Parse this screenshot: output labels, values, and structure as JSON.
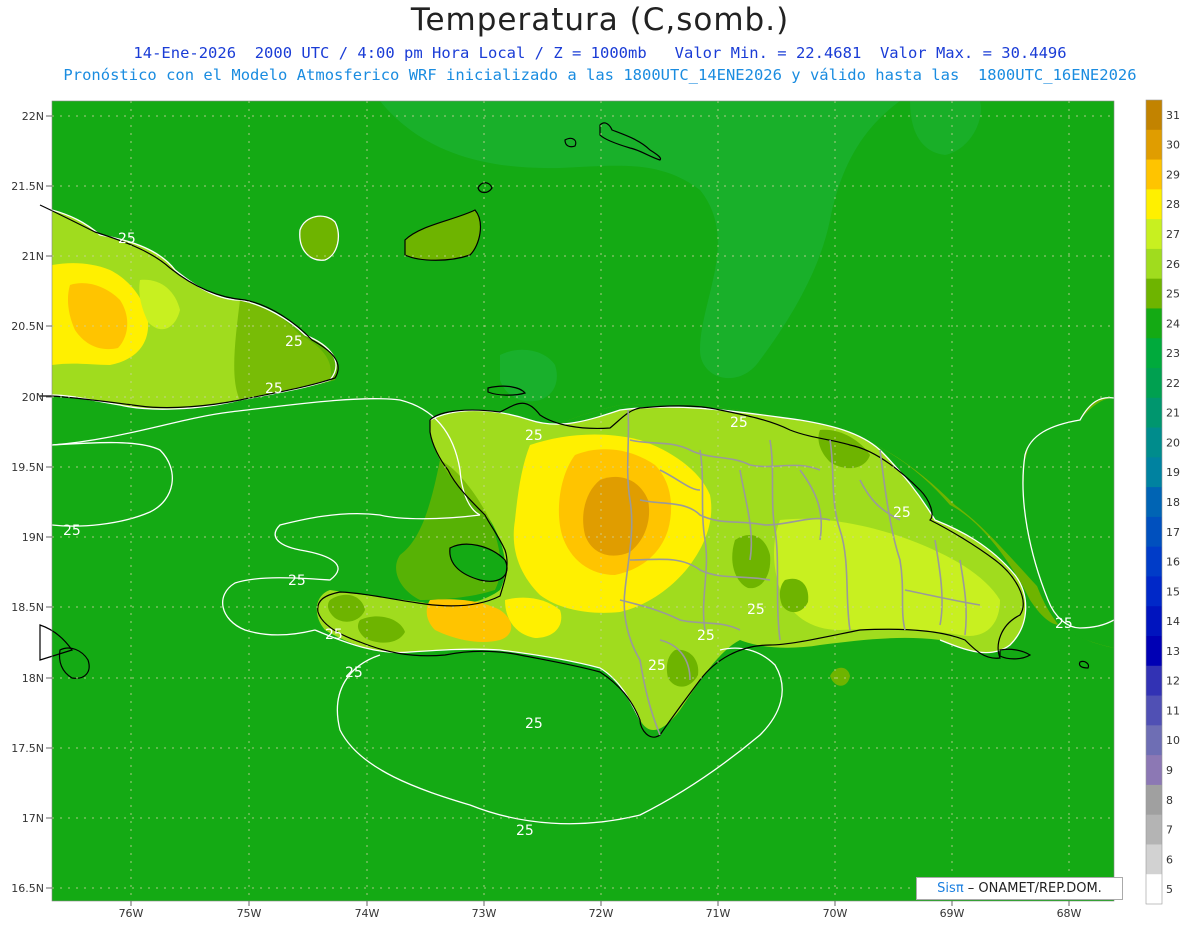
{
  "header": {
    "title": "Temperatura (C,somb.)",
    "subtitle1": "14-Ene-2026  2000 UTC / 4:00 pm Hora Local / Z = 1000mb   Valor Min. = 22.4681  Valor Max. = 30.4496",
    "subtitle2": "Pronóstico con el Modelo Atmosferico WRF inicializado a las 1800UTC_14ENE2026 y válido hasta las  1800UTC_16ENE2026"
  },
  "axes": {
    "lat_labels": [
      "22N",
      "21.5N",
      "21N",
      "20.5N",
      "20N",
      "19.5N",
      "19N",
      "18.5N",
      "18N",
      "17.5N",
      "17N",
      "16.5N"
    ],
    "lon_labels": [
      "76W",
      "75W",
      "74W",
      "73W",
      "72W",
      "71W",
      "70W",
      "69W",
      "68W"
    ]
  },
  "contour_labels": [
    "25",
    "25",
    "25",
    "25",
    "25",
    "25",
    "25",
    "25",
    "25",
    "25",
    "25",
    "25",
    "25",
    "25"
  ],
  "colorbar": {
    "labels": [
      "31",
      "30",
      "29",
      "28",
      "27",
      "26",
      "25",
      "24",
      "23",
      "22",
      "21",
      "20",
      "19",
      "18",
      "17",
      "16",
      "15",
      "14",
      "13",
      "12",
      "11",
      "10",
      "9",
      "8",
      "7",
      "6",
      "5"
    ],
    "colors": [
      "#c28300",
      "#e09d00",
      "#ffc400",
      "#fff000",
      "#c8f020",
      "#a0dc1e",
      "#6eb400",
      "#14aa14",
      "#00aa3c",
      "#00a050",
      "#00966e",
      "#008c8c",
      "#0082a0",
      "#0064b4",
      "#0050be",
      "#003cc8",
      "#0028c8",
      "#0014be",
      "#0000b4",
      "#3232b4",
      "#5050b4",
      "#6e6eb4",
      "#8c78b4",
      "#a0a0a0",
      "#b4b4b4",
      "#d2d2d2",
      "#ffffff"
    ]
  },
  "legend_colors": {
    "sea_olive": "#6eb400",
    "sea_green": "#14aa14",
    "warm_light": "#a0dc1e",
    "warm_yellow": "#fff000",
    "warm_gold": "#ffc400",
    "warm_orange": "#e09d00"
  },
  "credit": {
    "logo_text": "Sis",
    "logo_pi": "π",
    "text": "– ONAMET/REP.DOM."
  }
}
